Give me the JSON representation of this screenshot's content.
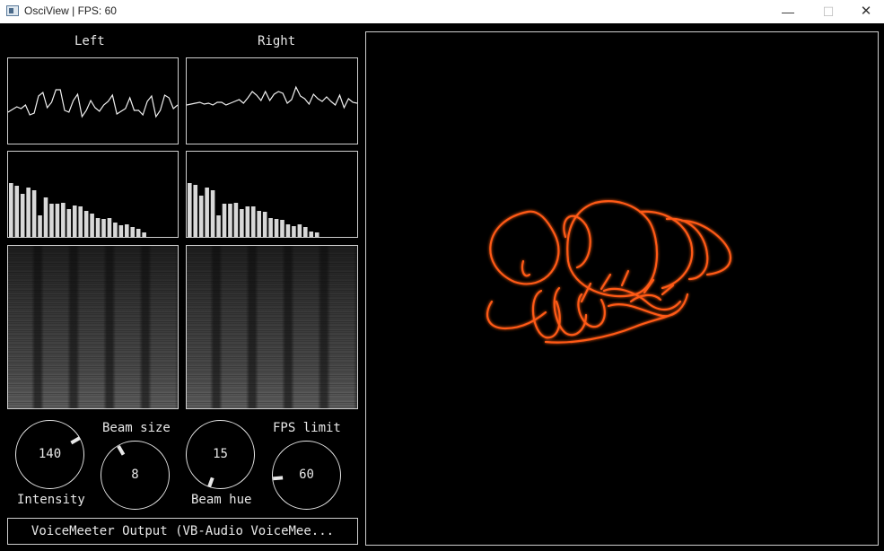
{
  "window": {
    "title": "OsciView | FPS: 60",
    "minimize": "—",
    "maximize": "☐",
    "close": "✕"
  },
  "channels": {
    "left_label": "Left",
    "right_label": "Right"
  },
  "knobs": [
    {
      "id": "intensity",
      "label": "Intensity",
      "value": "140",
      "angle_deg": 60
    },
    {
      "id": "beam-size",
      "label": "Beam size",
      "value": "8",
      "angle_deg": -30
    },
    {
      "id": "beam-hue",
      "label": "Beam hue",
      "value": "15",
      "angle_deg": -160
    },
    {
      "id": "fps-limit",
      "label": "FPS limit",
      "value": "60",
      "angle_deg": -95
    }
  ],
  "device": {
    "label": "VoiceMeeter Output (VB-Audio VoiceMee..."
  },
  "waveforms": {
    "left": [
      60,
      57,
      54,
      56,
      52,
      63,
      61,
      42,
      38,
      55,
      49,
      35,
      35,
      58,
      60,
      47,
      40,
      65,
      58,
      47,
      55,
      59,
      52,
      48,
      41,
      62,
      59,
      56,
      44,
      58,
      58,
      63,
      48,
      42,
      65,
      58,
      41,
      44,
      56,
      52
    ],
    "right": [
      52,
      51,
      50,
      49,
      51,
      50,
      52,
      49,
      49,
      52,
      50,
      48,
      46,
      50,
      44,
      37,
      41,
      47,
      37,
      47,
      40,
      37,
      39,
      50,
      46,
      32,
      42,
      45,
      51,
      40,
      45,
      48,
      43,
      48,
      52,
      41,
      55,
      45,
      49,
      50
    ]
  },
  "spectrum": {
    "left": [
      60,
      57,
      48,
      55,
      52,
      24,
      44,
      37,
      37,
      38,
      31,
      35,
      34,
      29,
      26,
      21,
      20,
      21,
      16,
      13,
      14,
      11,
      9,
      5
    ],
    "right": [
      60,
      58,
      46,
      55,
      52,
      24,
      37,
      37,
      38,
      31,
      34,
      34,
      29,
      28,
      21,
      20,
      19,
      14,
      12,
      14,
      11,
      6,
      5
    ]
  },
  "colors": {
    "beam": "#ff5a14",
    "beam_glow": "#b83a0a",
    "panel_border": "#cfcfcf"
  }
}
